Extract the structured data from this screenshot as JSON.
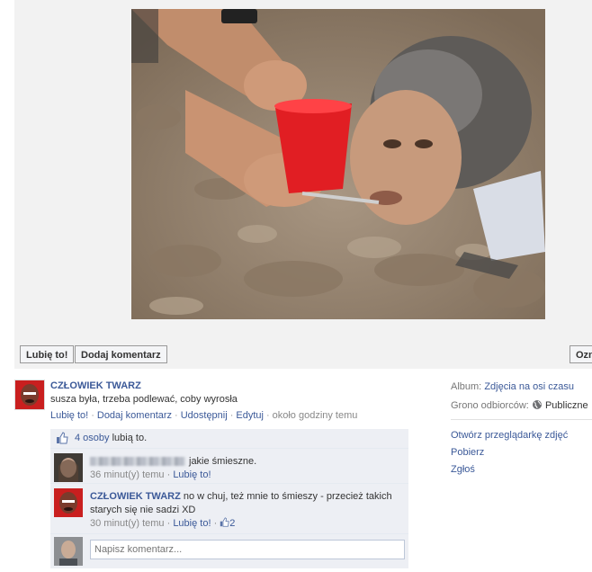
{
  "buttons": {
    "like": "Lubię to!",
    "comment": "Dodaj komentarz",
    "open": "Ozn"
  },
  "post": {
    "author": "CZŁOWIEK TWARZ",
    "text": "susza była, trzeba podlewać, coby wyrosła",
    "actions": {
      "like": "Lubię to!",
      "comment": "Dodaj komentarz",
      "share": "Udostępnij",
      "edit": "Edytuj",
      "time": "około godziny temu"
    }
  },
  "likes": {
    "count_link": "4 osoby",
    "suffix": "lubią to."
  },
  "comments": [
    {
      "author": "",
      "text": "jakie śmieszne.",
      "time": "36 minut(y) temu",
      "like": "Lubię to!"
    },
    {
      "author": "CZŁOWIEK TWARZ",
      "text": "no w chuj, też mnie to śmieszy - przecież takich starych się nie sadzi XD",
      "time": "30 minut(y) temu",
      "like": "Lubię to!",
      "like_count": "2"
    }
  ],
  "compose": {
    "placeholder": "Napisz komentarz..."
  },
  "sidebar": {
    "album_label": "Album:",
    "album_value": "Zdjęcia na osi czasu",
    "audience_label": "Grono odbiorców:",
    "audience_value": "Publiczne",
    "links": [
      "Otwórz przeglądarkę zdjęć",
      "Pobierz",
      "Zgłoś"
    ]
  },
  "icons": {
    "thumb": "thumbs-up-icon",
    "globe": "globe-icon"
  },
  "colors": {
    "link": "#3b5998",
    "feedback_bg": "#edeff4"
  }
}
